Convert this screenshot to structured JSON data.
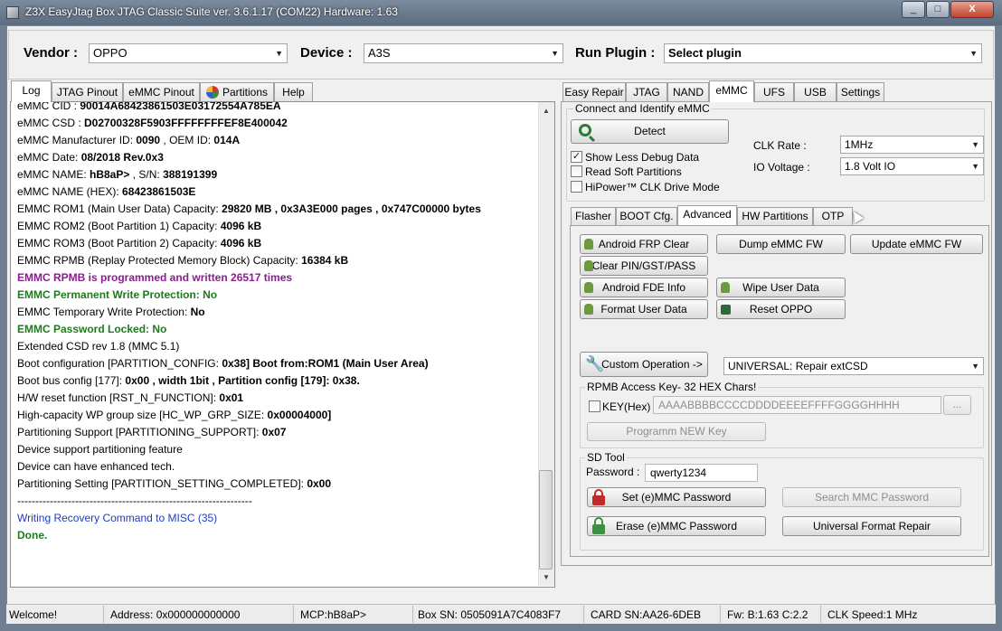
{
  "window": {
    "title": "Z3X EasyJtag Box JTAG Classic Suite ver. 3.6.1.17 (COM22) Hardware: 1.63",
    "minimize": "_",
    "maximize": "□",
    "close": "X"
  },
  "top": {
    "vendor_label": "Vendor :",
    "vendor_value": "OPPO",
    "device_label": "Device :",
    "device_value": "A3S",
    "plugin_label": "Run Plugin :",
    "plugin_value": "Select plugin"
  },
  "left_tabs": [
    "Log",
    "JTAG Pinout",
    "eMMC Pinout",
    "Partitions",
    "Help"
  ],
  "log": [
    {
      "parts": [
        {
          "t": "eMMC CID : ",
          "s": "n"
        },
        {
          "t": "90014A68423861503E03172554A785EA",
          "s": "b"
        }
      ]
    },
    {
      "parts": [
        {
          "t": "eMMC CSD : ",
          "s": "n"
        },
        {
          "t": "D02700328F5903FFFFFFFFEF8E400042",
          "s": "b"
        }
      ]
    },
    {
      "parts": [
        {
          "t": "eMMC Manufacturer ID: ",
          "s": "n"
        },
        {
          "t": "0090",
          "s": "b"
        },
        {
          "t": " , OEM ID: ",
          "s": "n"
        },
        {
          "t": "014A",
          "s": "b"
        }
      ]
    },
    {
      "parts": [
        {
          "t": "eMMC Date: ",
          "s": "n"
        },
        {
          "t": "08/2018  Rev.0x3",
          "s": "b"
        }
      ]
    },
    {
      "parts": [
        {
          "t": "eMMC NAME: ",
          "s": "n"
        },
        {
          "t": "hB8aP>",
          "s": "b"
        },
        {
          "t": " , S/N:  ",
          "s": "n"
        },
        {
          "t": "388191399",
          "s": "b"
        }
      ]
    },
    {
      "parts": [
        {
          "t": "eMMC NAME (HEX): ",
          "s": "n"
        },
        {
          "t": "68423861503E",
          "s": "b"
        }
      ]
    },
    {
      "parts": [
        {
          "t": "EMMC ROM1 (Main User Data)  Capacity: ",
          "s": "n"
        },
        {
          "t": "29820 MB , 0x3A3E000 pages , 0x747C00000 bytes",
          "s": "b"
        }
      ]
    },
    {
      "parts": [
        {
          "t": "EMMC ROM2 (Boot Partition 1) Capacity: ",
          "s": "n"
        },
        {
          "t": "4096 kB",
          "s": "b"
        }
      ]
    },
    {
      "parts": [
        {
          "t": "EMMC ROM3 (Boot Partition 2) Capacity: ",
          "s": "n"
        },
        {
          "t": "4096 kB",
          "s": "b"
        }
      ]
    },
    {
      "parts": [
        {
          "t": "EMMC RPMB (Replay Protected Memory Block) Capacity: ",
          "s": "n"
        },
        {
          "t": "16384 kB",
          "s": "b"
        }
      ]
    },
    {
      "parts": [
        {
          "t": "EMMC RPMB is programmed and written 26517 times",
          "s": "purple"
        }
      ]
    },
    {
      "parts": [
        {
          "t": "EMMC Permanent Write Protection: No",
          "s": "green"
        }
      ]
    },
    {
      "parts": [
        {
          "t": "EMMC Temporary Write Protection: ",
          "s": "n"
        },
        {
          "t": "No",
          "s": "b"
        }
      ]
    },
    {
      "parts": [
        {
          "t": "EMMC Password Locked: No",
          "s": "green"
        }
      ]
    },
    {
      "parts": [
        {
          "t": "  Extended CSD rev 1.8 (MMC 5.1)",
          "s": "n"
        }
      ]
    },
    {
      "parts": [
        {
          "t": "Boot configuration [PARTITION_CONFIG: ",
          "s": "n"
        },
        {
          "t": "0x38] Boot from:ROM1 (Main User Area)",
          "s": "b"
        }
      ]
    },
    {
      "parts": [
        {
          "t": "Boot bus config [177]: ",
          "s": "n"
        },
        {
          "t": "0x00 , width 1bit  , Partition config [179]: 0x38.",
          "s": "b"
        }
      ]
    },
    {
      "parts": [
        {
          "t": "H/W reset function [RST_N_FUNCTION]: ",
          "s": "n"
        },
        {
          "t": "0x01",
          "s": "b"
        }
      ]
    },
    {
      "parts": [
        {
          "t": "High-capacity WP group size [HC_WP_GRP_SIZE: ",
          "s": "n"
        },
        {
          "t": "0x00004000]",
          "s": "b"
        }
      ]
    },
    {
      "parts": [
        {
          "t": "Partitioning Support [PARTITIONING_SUPPORT]: ",
          "s": "n"
        },
        {
          "t": "0x07",
          "s": "b"
        }
      ]
    },
    {
      "parts": [
        {
          "t": " Device support partitioning feature",
          "s": "n"
        }
      ]
    },
    {
      "parts": [
        {
          "t": " Device can have enhanced tech.",
          "s": "n"
        }
      ]
    },
    {
      "parts": [
        {
          "t": "Partitioning Setting [PARTITION_SETTING_COMPLETED]: ",
          "s": "n"
        },
        {
          "t": "0x00",
          "s": "b"
        }
      ]
    },
    {
      "parts": [
        {
          "t": "-----------------------------------------------------------------",
          "s": "n"
        }
      ]
    },
    {
      "parts": [
        {
          "t": "Writing Recovery Command to MISC (35)",
          "s": "blue"
        }
      ]
    },
    {
      "parts": [
        {
          "t": "Done.",
          "s": "green"
        }
      ]
    }
  ],
  "right_tabs": [
    "Easy Repair",
    "JTAG",
    "NAND",
    "eMMC",
    "UFS",
    "USB",
    "Settings"
  ],
  "connect": {
    "group_label": "Connect and Identify eMMC",
    "detect": "Detect",
    "show_less_debug": "Show Less Debug Data",
    "show_less_debug_checked": true,
    "read_soft": "Read Soft Partitions",
    "read_soft_checked": false,
    "hipower": "HiPower™ CLK Drive Mode",
    "hipower_checked": false,
    "clk_label": "CLK Rate :",
    "clk_value": "1MHz",
    "io_label": "IO Voltage :",
    "io_value": "1.8 Volt IO"
  },
  "sub_tabs": [
    "Flasher",
    "BOOT Cfg.",
    "Advanced",
    "HW Partitions",
    "OTP"
  ],
  "advanced": {
    "android_frp": "Android FRP Clear",
    "dump_emmc": "Dump eMMC FW",
    "update_emmc": "Update eMMC FW",
    "clear_pin": "Clear PIN/GST/PASS",
    "android_fde": "Android FDE Info",
    "wipe_user": "Wipe User Data",
    "format_user": "Format User Data",
    "reset_oppo": "Reset OPPO",
    "custom_op": "Custom Operation ->",
    "custom_op_value": "UNIVERSAL: Repair extCSD",
    "rpmb_label": "RPMB Access Key- 32 HEX Chars!",
    "key_label": "KEY(Hex) :",
    "key_value": "AAAABBBBCCCCDDDDEEEEFFFFGGGGHHHH",
    "browse": "...",
    "program_key": "Programm NEW Key",
    "sd_label": "SD Tool",
    "password_label": "Password :",
    "password_value": "qwerty1234",
    "set_password": "Set (e)MMC Password",
    "search_password": "Search MMC Password",
    "erase_password": "Erase (e)MMC Password",
    "universal_format": "Universal Format Repair"
  },
  "status": {
    "welcome": "Welcome!",
    "address": "Address: 0x000000000000",
    "mcp": "MCP:hB8aP>",
    "box_sn": "Box SN: 0505091A7C4083F7",
    "card_sn": "CARD SN:AA26-6DEB",
    "fw": "Fw: B:1.63 C:2.2",
    "clk": "CLK Speed:1 MHz"
  },
  "colors": {
    "purple_text": "#8a1e8e",
    "green_text": "#1e7a1e",
    "blue_text": "#1c3cc8"
  }
}
